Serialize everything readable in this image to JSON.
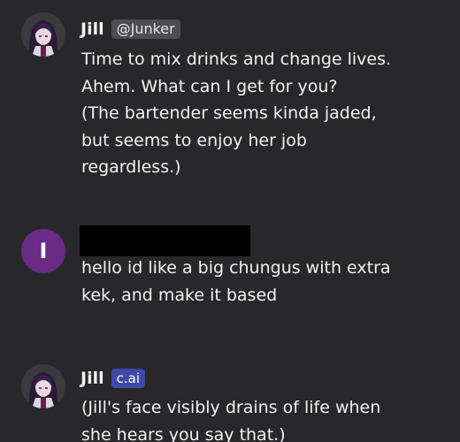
{
  "messages": [
    {
      "author": "Jill",
      "badge": "@Junker",
      "avatar_icon": "character-portrait-icon",
      "lines": [
        "Time to mix drinks and change lives.",
        "Ahem. What can I get for you?",
        "(The bartender seems kinda jaded,",
        "but seems to enjoy her job",
        "regardless.)"
      ]
    },
    {
      "avatar_letter": "I",
      "avatar_color": "#6b2a86",
      "lines": [
        "hello id like a big chungus with extra",
        "kek, and make it based"
      ]
    },
    {
      "author": "Jill",
      "badge": "c.ai",
      "avatar_icon": "character-portrait-icon",
      "lines": [
        "(Jill's face visibly drains of life when",
        "she hears you say that.)"
      ]
    }
  ],
  "colors": {
    "background": "#28282a",
    "text": "#f2f2f2",
    "handle_badge": "#4d4d52",
    "cai_badge": "#3e4aa6",
    "user_avatar": "#6b2a86"
  }
}
